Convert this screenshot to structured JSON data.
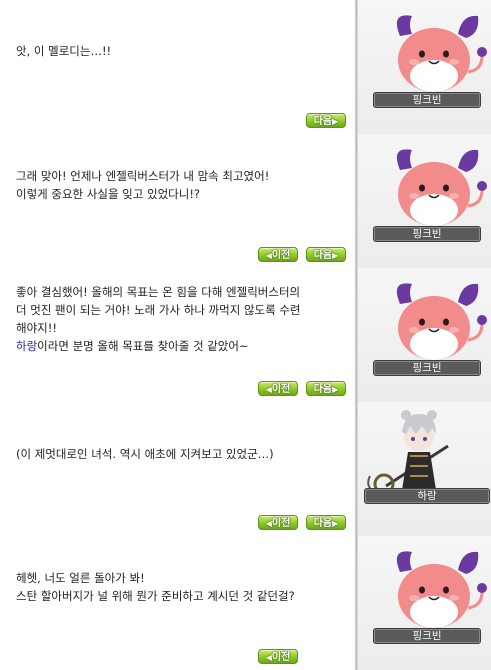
{
  "dialogs": [
    {
      "lines": [
        "앗, 이 멜로디는…!!"
      ],
      "buttons": {
        "prev": null,
        "next": "다음"
      },
      "npc": {
        "name": "핑크빈",
        "icon": "pink-bean"
      }
    },
    {
      "lines": [
        "그래 맞아! 언제나 엔젤릭버스터가 내 맘속 최고였어!",
        "이렇게 중요한 사실을 잊고 있었다니!?"
      ],
      "buttons": {
        "prev": "이전",
        "next": "다음"
      },
      "npc": {
        "name": "핑크빈",
        "icon": "pink-bean"
      }
    },
    {
      "lines": [
        "좋아 결심했어! 올해의 목표는 온 힘을 다해 엔젤릭버스터의",
        "더 멋진 팬이 되는 거야! 노래 가사 하나 까먹지 않도록 수련",
        "해야지!!"
      ],
      "highlight_name": "하랑",
      "last_line_rest": "이라면 분명 올해 목표를 찾아줄 것 같았어~",
      "buttons": {
        "prev": "이전",
        "next": "다음"
      },
      "npc": {
        "name": "핑크빈",
        "icon": "pink-bean"
      }
    },
    {
      "lines": [
        "(이 제멋대로인 녀석. 역시 애초에 지켜보고 있었군…)"
      ],
      "buttons": {
        "prev": "이전",
        "next": "다음"
      },
      "npc": {
        "name": "하랑",
        "icon": "harang"
      }
    },
    {
      "lines": [
        "헤헷, 너도 얼른 돌아가 봐!",
        "스탄 할아버지가 널 위해 뭔가 준비하고 계시던 것 같던걸?"
      ],
      "buttons": {
        "prev": "이전",
        "next": null
      },
      "npc": {
        "name": "핑크빈",
        "icon": "pink-bean"
      }
    }
  ],
  "colors": {
    "button_green": "#8fc92c",
    "nameplate": "#5a5a5a",
    "highlight": "#2233aa",
    "pink_bean_body": "#f28b8b",
    "pink_bean_ears": "#6b3aa0"
  }
}
